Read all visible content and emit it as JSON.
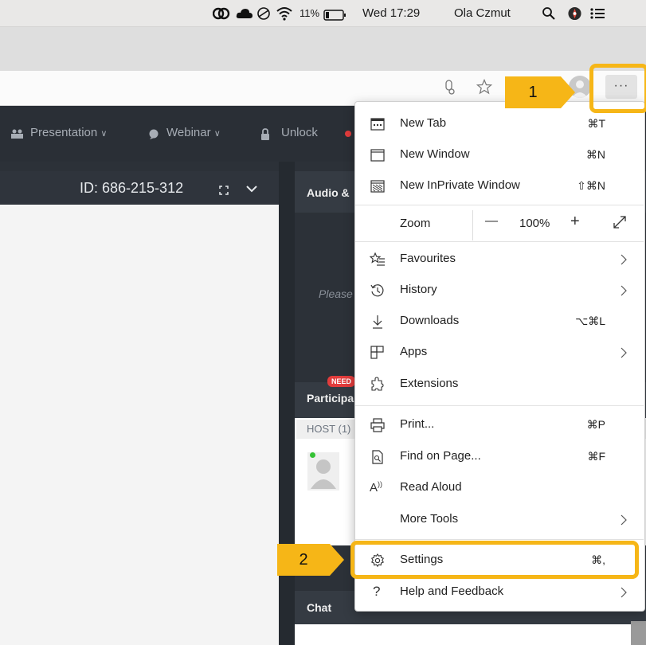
{
  "menubar": {
    "battery": "11%",
    "datetime": "Wed 17:29",
    "user": "Ola Czmut",
    "icons": [
      "creative-cloud-icon",
      "cloud-icon",
      "clock-icon",
      "wifi-icon",
      "battery-icon",
      "search-icon",
      "compass-icon",
      "list-icon"
    ]
  },
  "browser": {
    "more_label": "···"
  },
  "app": {
    "toolbar": {
      "presentation": "Presentation",
      "webinar": "Webinar",
      "unlock": "Unlock"
    },
    "meeting_id": "ID: 686-215-312",
    "audio_title": "Audio &",
    "please_text": "Please",
    "need_badge": "NEED",
    "participants_title": "Participa",
    "host_label": "HOST (1)",
    "chat_title": "Chat"
  },
  "menu": {
    "items": [
      {
        "label": "New Tab",
        "shortcut": "⌘T",
        "icon": "new-tab-icon"
      },
      {
        "label": "New Window",
        "shortcut": "⌘N",
        "icon": "new-window-icon"
      },
      {
        "label": "New InPrivate Window",
        "shortcut": "⇧⌘N",
        "icon": "inprivate-icon"
      },
      {
        "label": "Favourites",
        "shortcut": "",
        "icon": "favourites-icon"
      },
      {
        "label": "History",
        "shortcut": "",
        "icon": "history-icon"
      },
      {
        "label": "Downloads",
        "shortcut": "⌥⌘L",
        "icon": "downloads-icon"
      },
      {
        "label": "Apps",
        "shortcut": "",
        "icon": "apps-icon"
      },
      {
        "label": "Extensions",
        "shortcut": "",
        "icon": "extensions-icon"
      },
      {
        "label": "Print...",
        "shortcut": "⌘P",
        "icon": "print-icon"
      },
      {
        "label": "Find on Page...",
        "shortcut": "⌘F",
        "icon": "find-icon"
      },
      {
        "label": "Read Aloud",
        "shortcut": "",
        "icon": "read-aloud-icon"
      },
      {
        "label": "More Tools",
        "shortcut": "",
        "icon": ""
      },
      {
        "label": "Settings",
        "shortcut": "⌘,",
        "icon": "settings-icon"
      },
      {
        "label": "Help and Feedback",
        "shortcut": "",
        "icon": "help-icon"
      }
    ],
    "zoom": {
      "label": "Zoom",
      "minus": "—",
      "value": "100%",
      "plus": "+"
    }
  },
  "annotations": {
    "step1": "1",
    "step2": "2",
    "color": "#f6b617"
  }
}
